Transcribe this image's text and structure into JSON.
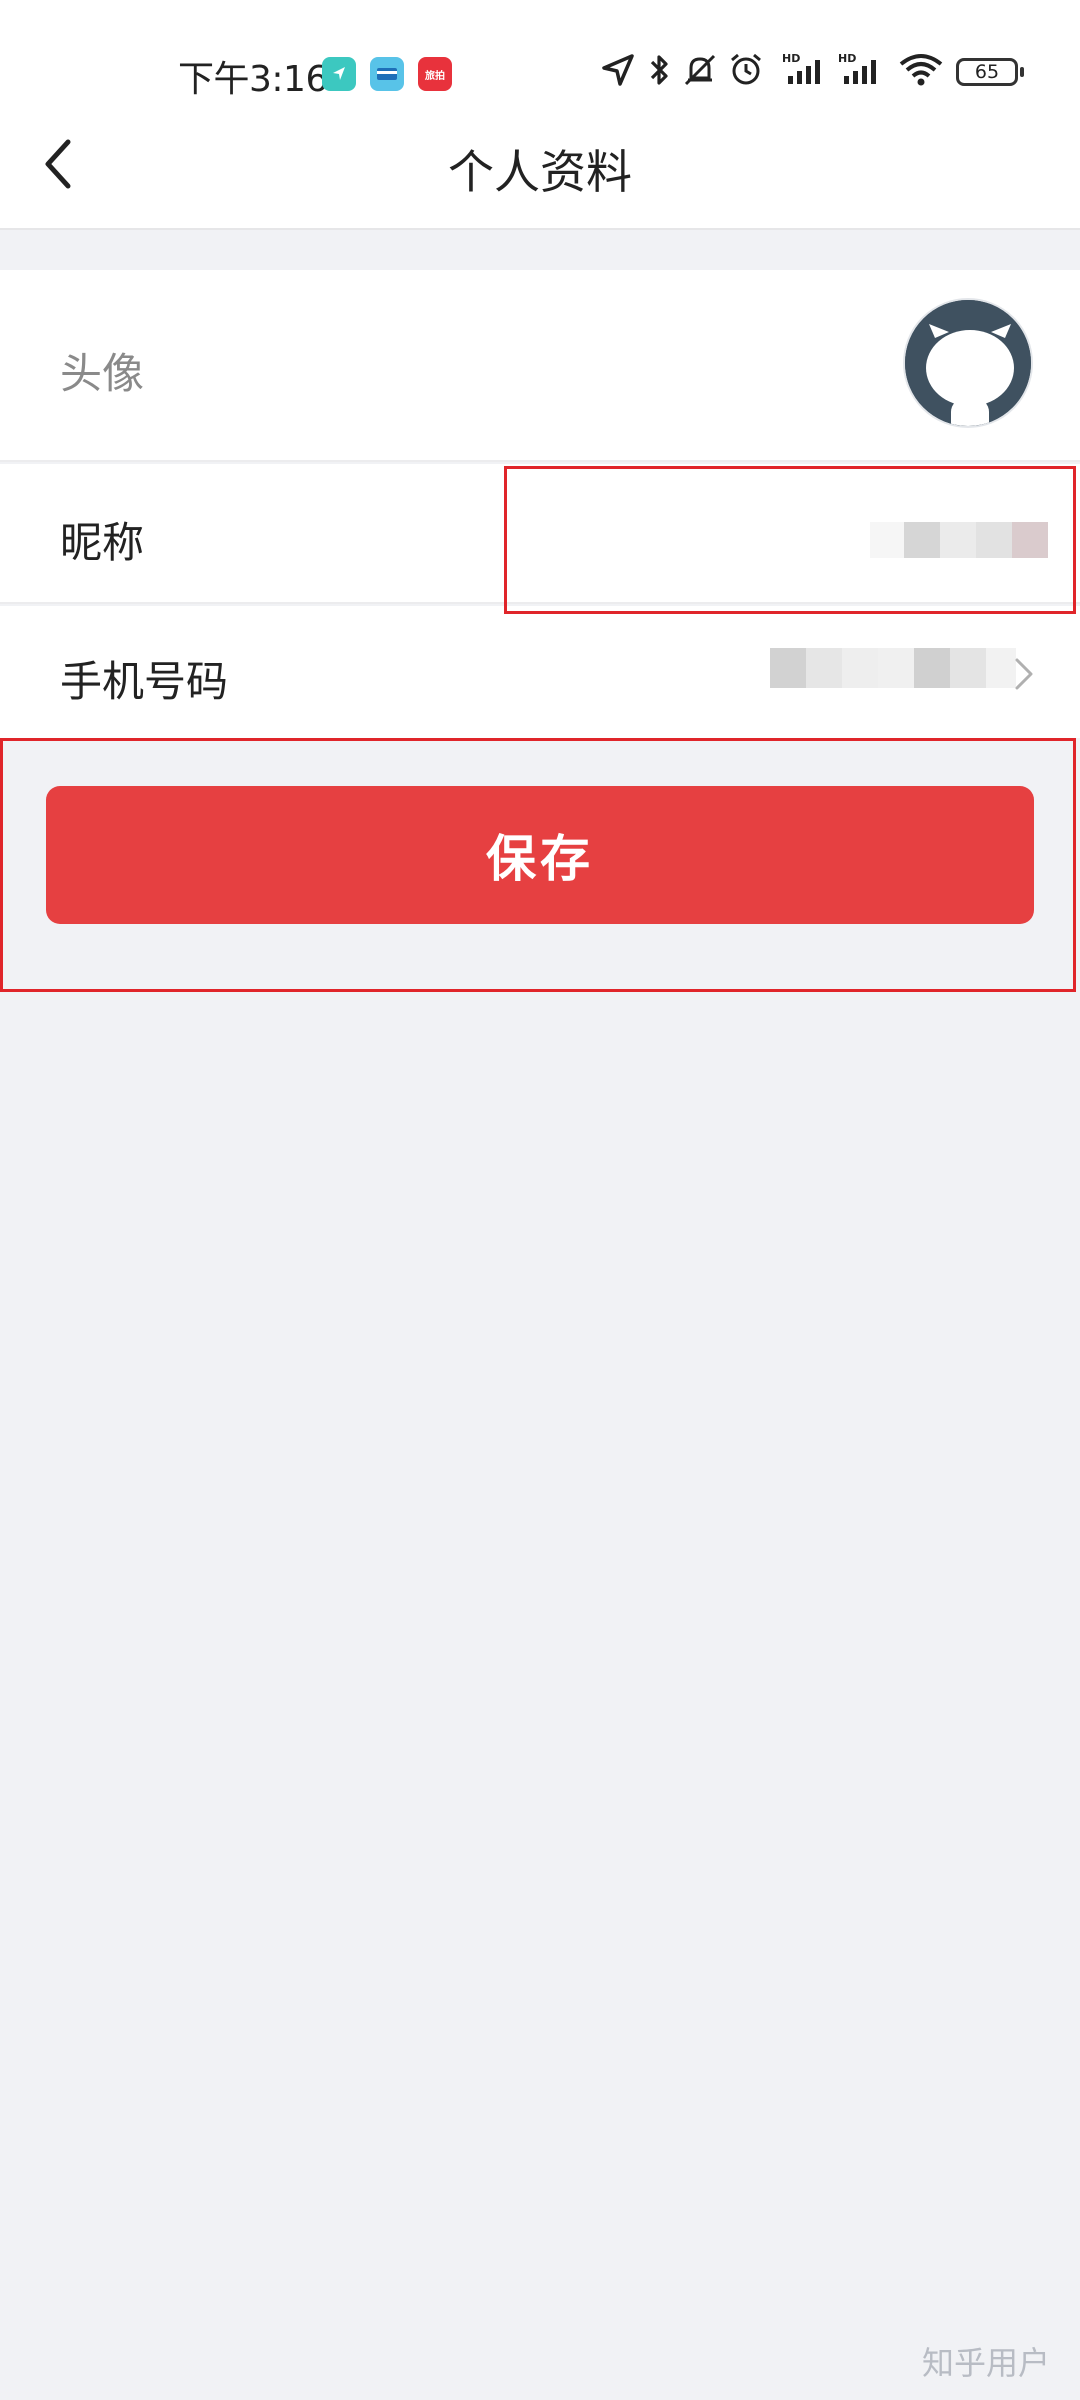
{
  "status_bar": {
    "time": "下午3:16",
    "network_labels": [
      "HD",
      "HD"
    ],
    "battery": "65",
    "notification_icons": [
      "navigation-app-icon",
      "wallet-app-icon",
      "news-app-icon"
    ],
    "notif3_text": "旅拍"
  },
  "nav": {
    "title": "个人资料",
    "back_icon": "chevron-left-icon"
  },
  "profile": {
    "avatar_label": "头像",
    "nickname_label": "昵称",
    "phone_label": "手机号码"
  },
  "actions": {
    "save_label": "保存"
  },
  "watermark": "知乎用户",
  "colors": {
    "accent": "#e64041",
    "highlight": "#e0252a",
    "page_bg": "#f1f2f5"
  }
}
